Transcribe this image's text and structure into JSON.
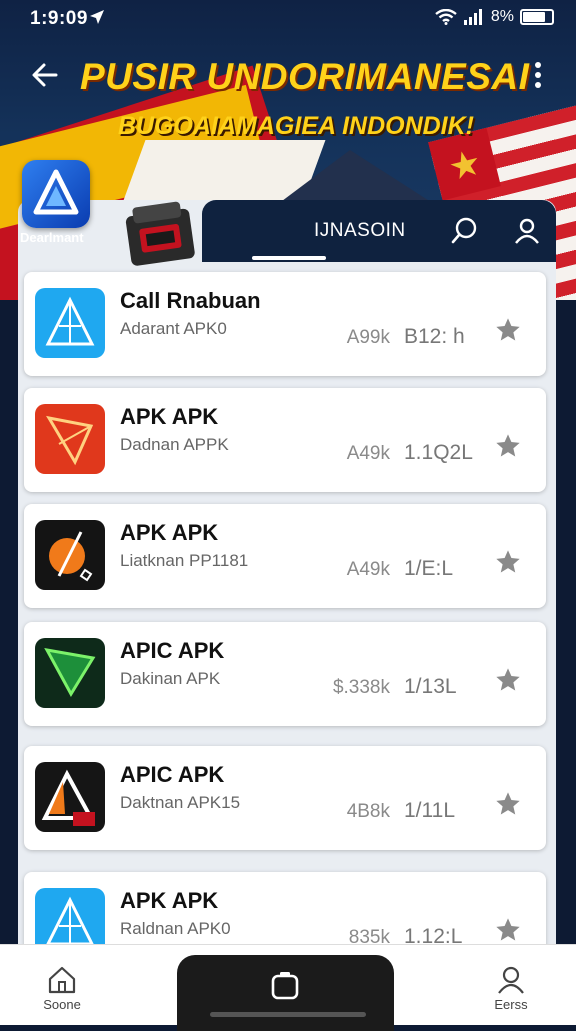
{
  "status_bar": {
    "time": "1:9:09",
    "battery_text": "8%",
    "battery_level": 0.8
  },
  "app_bar": {
    "title": "PUSIR UNDORIMANESAI"
  },
  "banner": {
    "subtitle": "BUGOAIAMAGIEA INDONDIK!",
    "brand_label": "Dearlmant"
  },
  "panel": {
    "tab_label": "IJNASOIN"
  },
  "apps": [
    {
      "name": "Call Rnabuan",
      "sub": "Adarant APK0",
      "size": "A99k",
      "count": "B12: h",
      "icon": "blue-triangle-icon"
    },
    {
      "name": "APK APK",
      "sub": "Dadnan APPK",
      "size": "A49k",
      "count": "1.1Q2L",
      "icon": "red-triangle-icon"
    },
    {
      "name": "APK APK",
      "sub": "Liatknan PP1181",
      "size": "A49k",
      "count": "1/E:L",
      "icon": "orange-leaf-icon"
    },
    {
      "name": "APIC APK",
      "sub": "Dakinan APK",
      "size": "$.338k",
      "count": "1/13L",
      "icon": "green-triangle-icon"
    },
    {
      "name": "APIC APK",
      "sub": "Daktnan APK15",
      "size": "4B8k",
      "count": "1/11L",
      "icon": "orange-triangle-icon"
    },
    {
      "name": "APK APK",
      "sub": "Raldnan APK0",
      "size": "835k",
      "count": "1.12:L",
      "icon": "blue-triangle-icon"
    }
  ],
  "bottom_nav": {
    "home_label": "Soone",
    "profile_label": "Eerss"
  },
  "colors": {
    "accent": "#ffd21a",
    "header": "#0f223f",
    "panel": "#e9edf2",
    "star": "#8a8a8a"
  }
}
